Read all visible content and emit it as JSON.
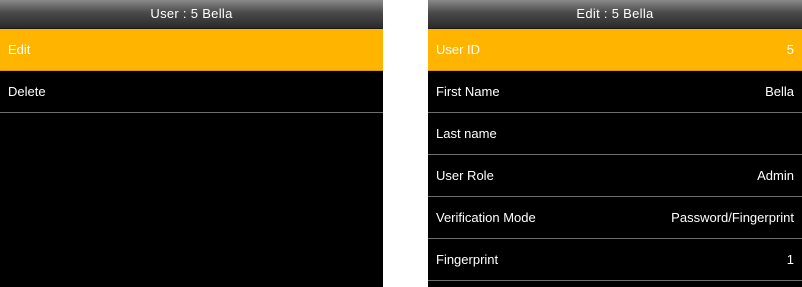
{
  "left_screen": {
    "title": "User : 5 Bella",
    "menu": [
      {
        "label": "Edit",
        "selected": true
      },
      {
        "label": "Delete",
        "selected": false
      }
    ]
  },
  "right_screen": {
    "title": "Edit : 5 Bella",
    "fields": [
      {
        "label": "User ID",
        "value": "5",
        "selected": true
      },
      {
        "label": "First Name",
        "value": "Bella",
        "selected": false
      },
      {
        "label": "Last name",
        "value": "",
        "selected": false
      },
      {
        "label": "User Role",
        "value": "Admin",
        "selected": false
      },
      {
        "label": "Verification Mode",
        "value": "Password/Fingerprint",
        "selected": false
      },
      {
        "label": "Fingerprint",
        "value": "1",
        "selected": false
      }
    ]
  },
  "colors": {
    "highlight": "#ffb400",
    "background": "#000000",
    "divider": "#6e6e6e"
  }
}
